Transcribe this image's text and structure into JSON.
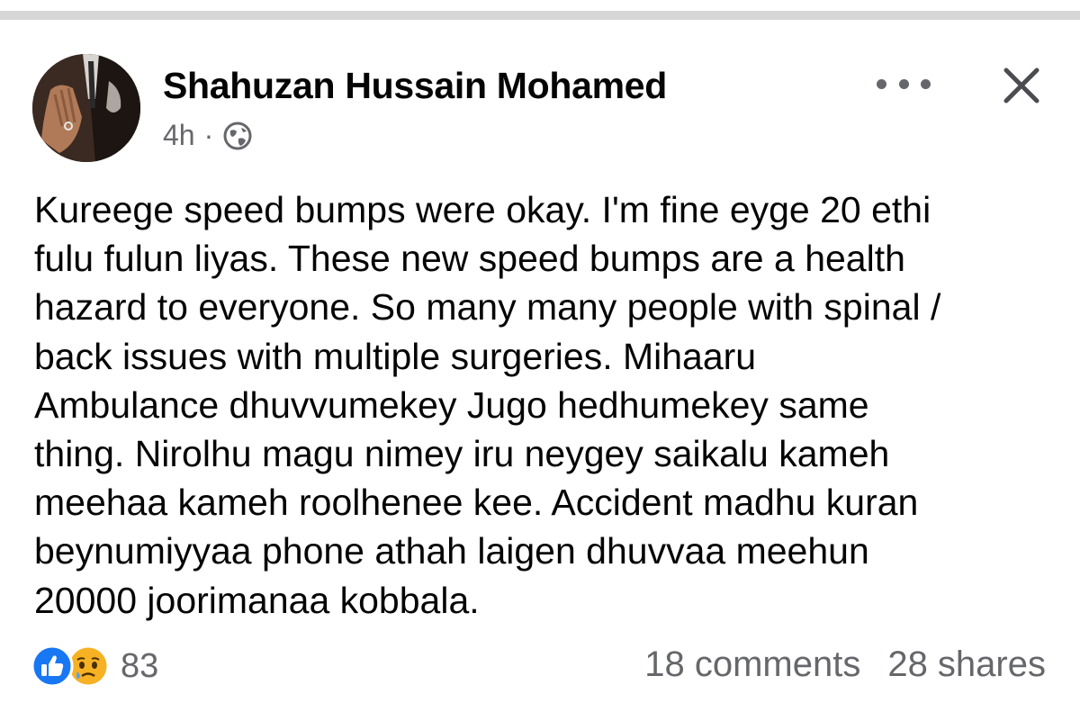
{
  "post": {
    "author": "Shahuzan Hussain Mohamed",
    "time": "4h",
    "separator": "·",
    "audience_icon": "globe-icon",
    "text": "Kureege speed bumps were okay. I'm fine eyge 20 ethi\nfulu fulun liyas. These new speed bumps are a health\nhazard to everyone. So many many people with spinal /\nback issues with multiple surgeries. Mihaaru\nAmbulance dhuvvumekey Jugo hedhumekey same\nthing. Nirolhu magu nimey iru neygey saikalu kameh\nmeehaa kameh roolhenee kee. Accident madhu kuran\nbeynumiyyaa phone athah laigen dhuvvaa meehun\n20000 joorimanaa kobbala."
  },
  "footer": {
    "reaction_count": "83",
    "comments": "18 comments",
    "shares": "28 shares"
  },
  "icons": {
    "more": "more-icon",
    "close": "close-icon",
    "like": "like-icon",
    "sad": "sad-icon"
  },
  "colors": {
    "text": "#050505",
    "secondary": "#65676b",
    "like_blue": "#1877f2",
    "sad_yellow": "#f7b125",
    "top_bar": "#d6d6d6"
  }
}
